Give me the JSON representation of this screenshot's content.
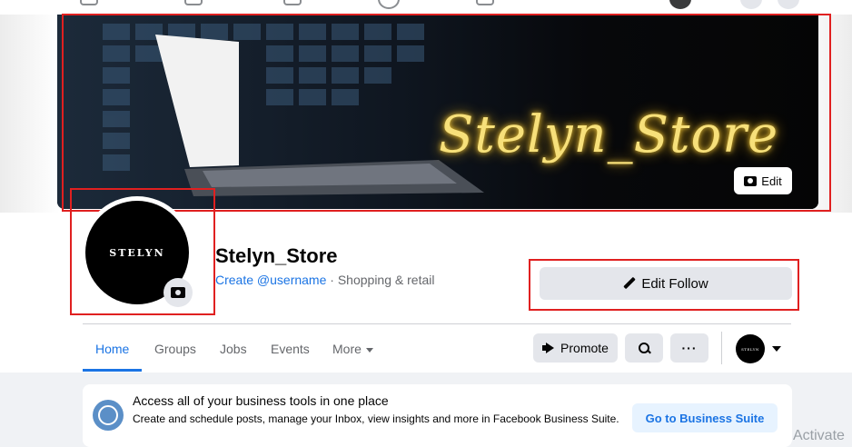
{
  "cover": {
    "script_text": "Stelyn_Store",
    "edit_label": "Edit"
  },
  "profile": {
    "avatar_text": "STELYN",
    "name": "Stelyn_Store",
    "username_link": "Create @username",
    "separator": " · ",
    "category": "Shopping & retail"
  },
  "actions": {
    "edit_follow_label": "Edit Follow"
  },
  "tabs": [
    {
      "label": "Home",
      "active": true
    },
    {
      "label": "Groups",
      "active": false
    },
    {
      "label": "Jobs",
      "active": false
    },
    {
      "label": "Events",
      "active": false
    },
    {
      "label": "More",
      "active": false
    }
  ],
  "toolbar": {
    "promote_label": "Promote",
    "more_label": "···",
    "mini_avatar_text": "STELYN"
  },
  "business_card": {
    "title": "Access all of your business tools in one place",
    "body": "Create and schedule posts, manage your Inbox, view insights and more in Facebook Business Suite.",
    "button_label": "Go to Business Suite"
  },
  "overlay": {
    "watermark": "Activate"
  },
  "colors": {
    "accent": "#1b74e4",
    "annotation": "#e02020",
    "button_gray": "#e4e6eb",
    "neon": "#f7e07a"
  }
}
